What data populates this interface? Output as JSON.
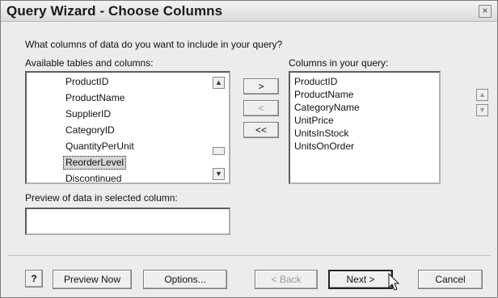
{
  "window": {
    "title": "Query Wizard - Choose Columns",
    "close_glyph": "×"
  },
  "question": "What columns of data do you want to include in your query?",
  "available": {
    "label": "Available tables and columns:",
    "items": [
      "ProductID",
      "ProductName",
      "SupplierID",
      "CategoryID",
      "QuantityPerUnit",
      "ReorderLevel",
      "Discontinued"
    ],
    "selected": "ReorderLevel"
  },
  "query_columns": {
    "label": "Columns in your query:",
    "items": [
      "ProductID",
      "ProductName",
      "CategoryName",
      "UnitPrice",
      "UnitsInStock",
      "UnitsOnOrder"
    ]
  },
  "move_buttons": {
    "add": ">",
    "remove": "<",
    "remove_all": "<<"
  },
  "preview": {
    "label": "Preview of data in selected column:",
    "value": ""
  },
  "buttons": {
    "help": "?",
    "preview_now": "Preview Now",
    "options": "Options...",
    "back": "< Back",
    "next": "Next >",
    "cancel": "Cancel"
  },
  "icons": {
    "scroll_up": "up-arrow",
    "scroll_down": "down-arrow",
    "cursor": "pointer-arrow"
  }
}
